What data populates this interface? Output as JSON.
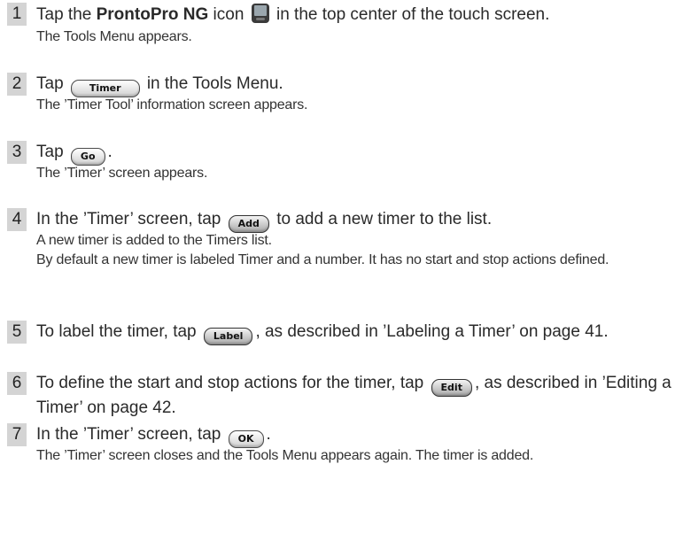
{
  "steps": [
    {
      "number": "1",
      "pre": "Tap the ",
      "bold": "ProntoPro NG",
      "mid": " icon",
      "post": " in the top center of the touch screen.",
      "results": [
        "The Tools Menu appears."
      ]
    },
    {
      "number": "2",
      "pre": "Tap ",
      "button": "Timer",
      "post": " in the Tools Menu.",
      "results": [
        "The ’Timer Tool’ information screen appears."
      ]
    },
    {
      "number": "3",
      "pre": "Tap ",
      "button": "Go",
      "post": ".",
      "results": [
        "The ’Timer’ screen appears."
      ]
    },
    {
      "number": "4",
      "pre": "In the ’Timer’ screen, tap ",
      "button": "Add",
      "post": " to add a new timer to the list.",
      "results": [
        "A new timer is added to the Timers list.",
        "By default a new timer is labeled Timer and a number. It has no start and stop actions defined."
      ]
    },
    {
      "number": "5",
      "pre": "To label the timer, tap ",
      "button": "Label",
      "post": ", as described in ’Labeling a Timer’ on page 41.",
      "results": []
    },
    {
      "number": "6",
      "pre": "To define the start and stop actions for the timer, tap ",
      "button": "Edit",
      "post": ", as described in ’Editing a Timer’ on page 42.",
      "results": []
    },
    {
      "number": "7",
      "pre": "In the ’Timer’ screen, tap ",
      "button": "OK",
      "post": ".",
      "results": [
        "The ’Timer’ screen closes and the Tools Menu appears again. The timer is added."
      ]
    }
  ],
  "icons": {
    "device": "handheld-remote-icon"
  }
}
